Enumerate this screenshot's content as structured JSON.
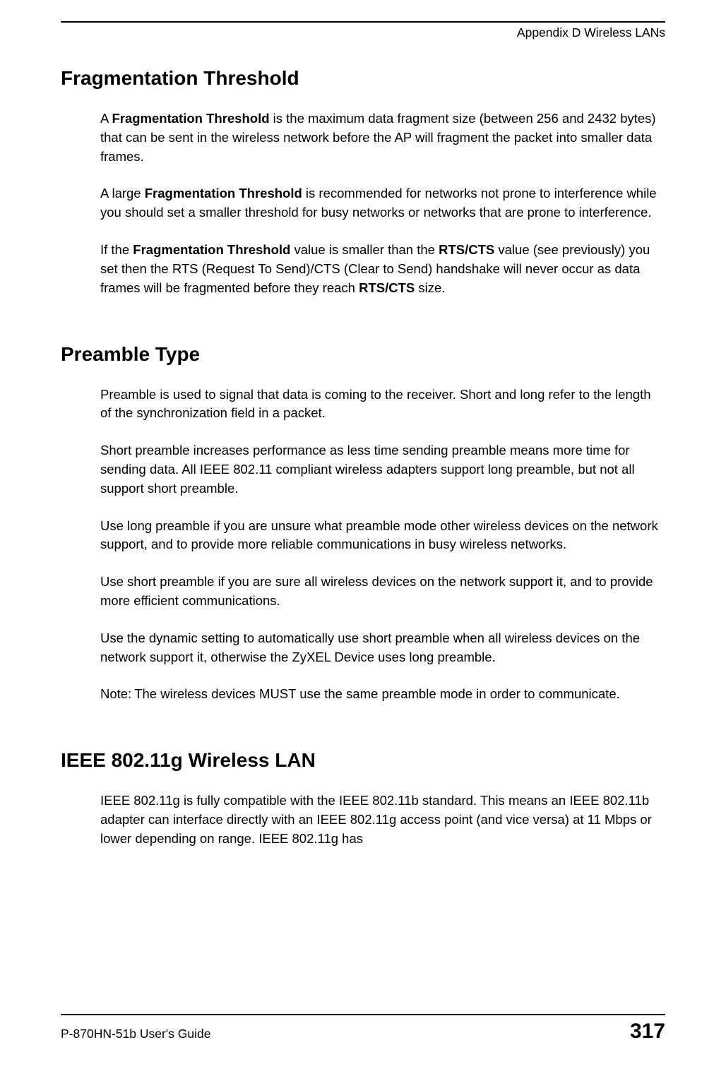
{
  "header": {
    "right": "Appendix D Wireless LANs"
  },
  "sections": {
    "frag": {
      "heading": "Fragmentation Threshold",
      "p1_a": "A ",
      "p1_b": "Fragmentation Threshold",
      "p1_c": " is the maximum data fragment size (between 256 and 2432 bytes) that can be sent in the wireless network before the AP will fragment the packet into smaller data frames.",
      "p2_a": "A large ",
      "p2_b": "Fragmentation Threshold",
      "p2_c": " is recommended for networks not prone to interference while you should set a smaller threshold for busy networks or networks that are prone to interference.",
      "p3_a": "If the ",
      "p3_b": "Fragmentation Threshold",
      "p3_c": " value is smaller than the ",
      "p3_d": "RTS/CTS",
      "p3_e": " value (see previously) you set then the RTS (Request To Send)/CTS (Clear to Send) handshake will never occur as data frames will be fragmented before they reach ",
      "p3_f": "RTS/CTS",
      "p3_g": " size."
    },
    "preamble": {
      "heading": "Preamble Type",
      "p1": "Preamble is used to signal that data is coming to the receiver. Short and long refer to the length of the synchronization field in a packet.",
      "p2": "Short preamble increases performance as less time sending preamble means more time for sending data. All IEEE 802.11 compliant wireless adapters support long preamble, but not all support short preamble.",
      "p3": "Use long preamble if you are unsure what preamble mode other wireless devices on the network support, and to provide more reliable communications in busy wireless networks.",
      "p4": "Use short preamble if you are sure all wireless devices on the network support it, and to provide more efficient communications.",
      "p5": "Use the dynamic setting to automatically use short preamble when all wireless devices on the network support it, otherwise the ZyXEL Device uses long preamble.",
      "note_label": "Note: ",
      "note_body": "The wireless devices MUST use the same preamble mode in order to communicate."
    },
    "ieee": {
      "heading": "IEEE 802.11g Wireless LAN",
      "p1": "IEEE 802.11g is fully compatible with the IEEE 802.11b standard. This means an IEEE 802.11b adapter can interface directly with an IEEE 802.11g access point (and vice versa) at 11 Mbps or lower depending on range. IEEE 802.11g has"
    }
  },
  "footer": {
    "left": "P-870HN-51b User's Guide",
    "right": "317"
  }
}
